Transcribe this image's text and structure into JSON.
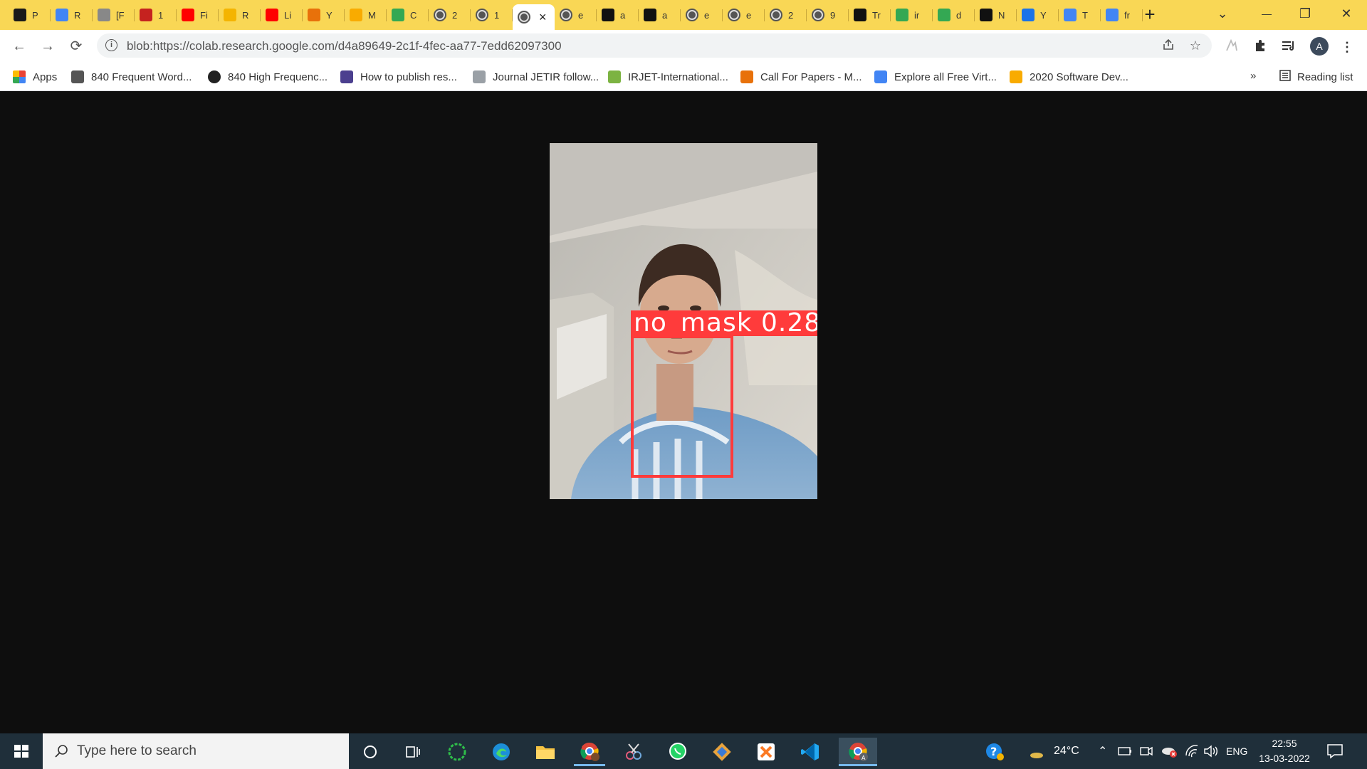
{
  "browser": {
    "tabs": [
      {
        "title": "P",
        "favicon": "pocket-icon",
        "color": "#1a1a1a"
      },
      {
        "title": "R",
        "favicon": "docs-icon",
        "color": "#4285f4"
      },
      {
        "title": "[F",
        "favicon": "flag-icon",
        "color": "#888888"
      },
      {
        "title": "1",
        "favicon": "pdf-icon",
        "color": "#c5221f"
      },
      {
        "title": "Fi",
        "favicon": "youtube-icon",
        "color": "#ff0000"
      },
      {
        "title": "R",
        "favicon": "slides-icon",
        "color": "#f4b400"
      },
      {
        "title": "Li",
        "favicon": "youtube-icon",
        "color": "#ff0000"
      },
      {
        "title": "Y",
        "favicon": "colab-icon",
        "color": "#e8710a"
      },
      {
        "title": "M",
        "favicon": "colab-icon",
        "color": "#f9ab00"
      },
      {
        "title": "C",
        "favicon": "drive-icon",
        "color": "#34a853"
      },
      {
        "title": "2",
        "favicon": "globe-icon",
        "color": "#555555"
      },
      {
        "title": "1",
        "favicon": "globe-icon",
        "color": "#555555"
      },
      {
        "title": "",
        "favicon": "globe-icon",
        "color": "#555555",
        "active": true
      },
      {
        "title": "e",
        "favicon": "globe-icon",
        "color": "#555555"
      },
      {
        "title": "a",
        "favicon": "github-icon",
        "color": "#111111"
      },
      {
        "title": "a",
        "favicon": "github-icon",
        "color": "#111111"
      },
      {
        "title": "e",
        "favicon": "globe-icon",
        "color": "#555555"
      },
      {
        "title": "e",
        "favicon": "globe-icon",
        "color": "#555555"
      },
      {
        "title": "2",
        "favicon": "globe-icon",
        "color": "#555555"
      },
      {
        "title": "9",
        "favicon": "globe-icon",
        "color": "#555555"
      },
      {
        "title": "Tr",
        "favicon": "github-icon",
        "color": "#111111"
      },
      {
        "title": "ir",
        "favicon": "drive-icon",
        "color": "#34a853"
      },
      {
        "title": "d",
        "favicon": "drive-icon",
        "color": "#34a853"
      },
      {
        "title": "N",
        "favicon": "chip-icon",
        "color": "#111111"
      },
      {
        "title": "Y",
        "favicon": "k-icon",
        "color": "#1a73e8"
      },
      {
        "title": "T",
        "favicon": "google-icon",
        "color": "#4285f4"
      },
      {
        "title": "fr",
        "favicon": "google-icon",
        "color": "#4285f4"
      }
    ],
    "active_tab_close": "×",
    "new_tab": "+",
    "window_controls": {
      "tab_search": "⌄",
      "minimize": "—",
      "restore": "❐",
      "close": "✕"
    }
  },
  "toolbar": {
    "back": "←",
    "forward": "→",
    "reload": "⟳",
    "url": "blob:https://colab.research.google.com/d4a89649-2c1f-4fec-aa77-7edd62097300",
    "avatar_letter": "A"
  },
  "bookmarks": {
    "items": [
      {
        "label": "Apps",
        "icon": "apps-grid-icon",
        "color": "#4285f4"
      },
      {
        "label": "840 Frequent Word...",
        "icon": "g-script-icon",
        "color": "#555555"
      },
      {
        "label": "840 High Frequenc...",
        "icon": "globe-icon",
        "color": "#222222"
      },
      {
        "label": "How to publish res...",
        "icon": "dots-icon",
        "color": "#4b3f8f"
      },
      {
        "label": "Journal JETIR follow...",
        "icon": "shield-icon",
        "color": "#9aa0a6"
      },
      {
        "label": "IRJET-International...",
        "icon": "irjet-icon",
        "color": "#7cb342"
      },
      {
        "label": "Call For Papers - M...",
        "icon": "e-icon",
        "color": "#e8710a"
      },
      {
        "label": "Explore all Free Virt...",
        "icon": "diamond-icon",
        "color": "#4285f4"
      },
      {
        "label": "2020 Software Dev...",
        "icon": "bracket-icon",
        "color": "#f9ab00"
      }
    ],
    "overflow": "»",
    "reading_list": "Reading list"
  },
  "content": {
    "detection_label": "no_mask 0.28",
    "colors": {
      "box": "#ff3b3b",
      "background": "#0e0e0e"
    }
  },
  "taskbar": {
    "search_placeholder": "Type here to search",
    "weather": "24°C",
    "language": "ENG",
    "time": "22:55",
    "date": "13-03-2022"
  }
}
